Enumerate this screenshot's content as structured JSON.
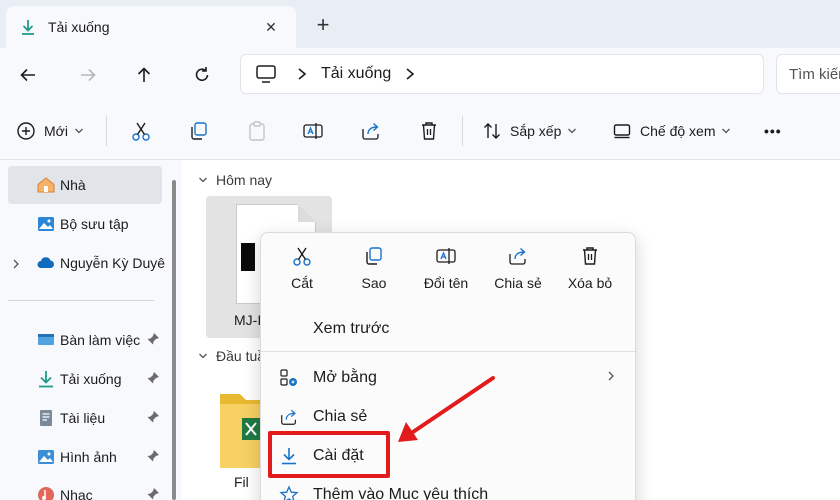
{
  "window": {
    "tab_title": "Tải xuống",
    "new_tab_symbol": "+",
    "close_symbol": "✕"
  },
  "nav": {
    "breadcrumb_current": "Tải xuống",
    "search_placeholder": "Tìm kiếm"
  },
  "toolbar": {
    "new_label": "Mới",
    "sort_label": "Sắp xếp",
    "view_label": "Chế độ xem",
    "more_symbol": "•••"
  },
  "sidebar": {
    "items": [
      {
        "label": "Nhà",
        "icon": "home-icon"
      },
      {
        "label": "Bộ sưu tập",
        "icon": "gallery-icon"
      },
      {
        "label": "Nguyễn Kỳ Duyê",
        "icon": "onedrive-icon"
      },
      {
        "label": "Bàn làm việc",
        "icon": "desktop-icon"
      },
      {
        "label": "Tải xuống",
        "icon": "download-icon"
      },
      {
        "label": "Tài liệu",
        "icon": "document-icon"
      },
      {
        "label": "Hình ảnh",
        "icon": "pictures-icon"
      },
      {
        "label": "Nhạc",
        "icon": "music-icon"
      }
    ]
  },
  "content": {
    "group_today": "Hôm nay",
    "group_earlier": "Đầu tuầ",
    "file_name": "MJ-I",
    "folder_label": "Fil"
  },
  "context_menu": {
    "actions": [
      {
        "label": "Cắt",
        "icon": "cut-icon"
      },
      {
        "label": "Sao",
        "icon": "copy-icon"
      },
      {
        "label": "Đổi tên",
        "icon": "rename-icon"
      },
      {
        "label": "Chia sẻ",
        "icon": "share-icon"
      },
      {
        "label": "Xóa bỏ",
        "icon": "delete-icon"
      }
    ],
    "items": [
      {
        "label": "Xem trước"
      },
      {
        "label": "Mở bằng",
        "has_submenu": true
      },
      {
        "label": "Chia sẻ"
      },
      {
        "label": "Cài đặt"
      },
      {
        "label": "Thêm vào Mục yêu thích"
      }
    ]
  },
  "colors": {
    "annotation_red": "#e21c1c",
    "accent_blue": "#1a73c8",
    "download_teal": "#1e9b8a"
  }
}
